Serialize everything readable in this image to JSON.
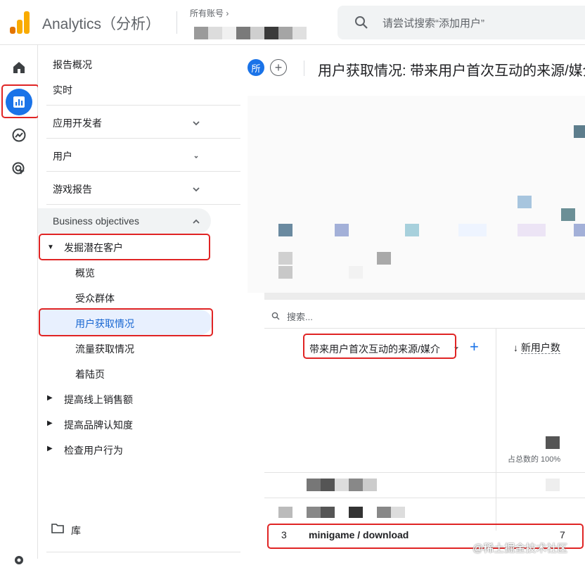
{
  "app": {
    "brand": "Analytics（分析）",
    "account_label": "所有账号 ›"
  },
  "search": {
    "placeholder": "请尝试搜索“添加用户”"
  },
  "rail": {
    "items": [
      "home-icon",
      "reports-icon",
      "explore-icon",
      "advertising-icon"
    ]
  },
  "sidebar": {
    "overview": "报告概况",
    "realtime": "实时",
    "app_developer": "应用开发者",
    "user": "用户",
    "game_reports": "游戏报告",
    "business_objectives": "Business objectives",
    "find_leads": "发掘潜在客户",
    "sub_items": [
      "概览",
      "受众群体",
      "用户获取情况",
      "流量获取情况",
      "着陆页"
    ],
    "collapsed": [
      "提高线上销售额",
      "提高品牌认知度",
      "检查用户行为"
    ],
    "library": "库"
  },
  "main": {
    "compare_chip": "所",
    "add_chip": "+",
    "title": "用户获取情况: 带来用户首次互动的来源/媒介",
    "table": {
      "search_placeholder": "搜索...",
      "dimension_header": "带来用户首次互动的来源/媒介",
      "add_dimension": "+",
      "metric_header": "新用户数",
      "sort_arrow": "↓",
      "total_pct": "占总数的 100%",
      "row": {
        "index": "3",
        "source": "minigame / download",
        "value": "7"
      }
    }
  },
  "watermark": "@稀土掘金技术社区",
  "colors": {
    "accent": "#1a73e8",
    "highlight": "#e02424",
    "logo_orange": "#f9ab00",
    "logo_dark": "#e37400"
  }
}
